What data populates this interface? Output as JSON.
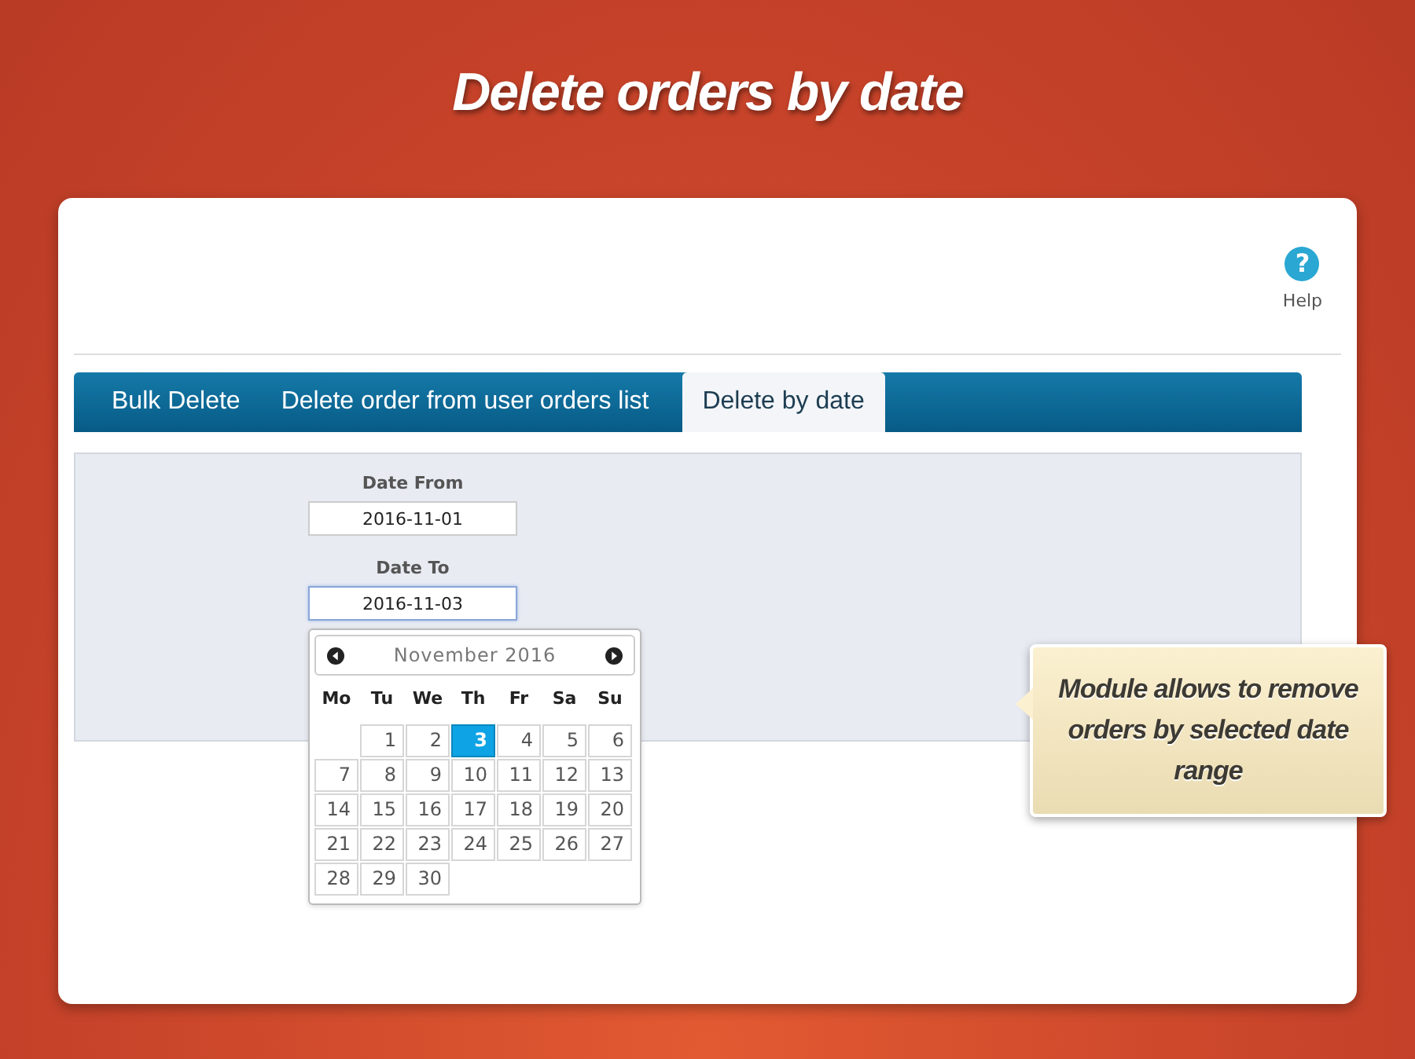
{
  "headline": "Delete orders by date",
  "help": {
    "icon_glyph": "?",
    "label": "Help"
  },
  "tabs": [
    {
      "label": "Bulk Delete",
      "selected": false
    },
    {
      "label": "Delete order from user orders list",
      "selected": false
    },
    {
      "label": "Delete by date",
      "selected": true
    }
  ],
  "fields": [
    {
      "label": "Date From",
      "value": "2016-11-01",
      "focused": false
    },
    {
      "label": "Date To",
      "value": "2016-11-03",
      "focused": true
    }
  ],
  "calendar": {
    "month_label": "November 2016",
    "weekdays": [
      "Mo",
      "Tu",
      "We",
      "Th",
      "Fr",
      "Sa",
      "Su"
    ],
    "weeks": [
      [
        {
          "label": "1",
          "selected": false
        },
        {
          "label": "2",
          "selected": false
        },
        {
          "label": "3",
          "selected": true
        },
        {
          "label": "4",
          "selected": false
        },
        {
          "label": "5",
          "selected": false
        },
        {
          "label": "6",
          "selected": false
        }
      ],
      [
        {
          "label": "7",
          "selected": false
        },
        {
          "label": "8",
          "selected": false
        },
        {
          "label": "9",
          "selected": false
        },
        {
          "label": "10",
          "selected": false
        },
        {
          "label": "11",
          "selected": false
        },
        {
          "label": "12",
          "selected": false
        },
        {
          "label": "13",
          "selected": false
        }
      ],
      [
        {
          "label": "14",
          "selected": false
        },
        {
          "label": "15",
          "selected": false
        },
        {
          "label": "16",
          "selected": false
        },
        {
          "label": "17",
          "selected": false
        },
        {
          "label": "18",
          "selected": false
        },
        {
          "label": "19",
          "selected": false
        },
        {
          "label": "20",
          "selected": false
        }
      ],
      [
        {
          "label": "21",
          "selected": false
        },
        {
          "label": "22",
          "selected": false
        },
        {
          "label": "23",
          "selected": false
        },
        {
          "label": "24",
          "selected": false
        },
        {
          "label": "25",
          "selected": false
        },
        {
          "label": "26",
          "selected": false
        },
        {
          "label": "27",
          "selected": false
        }
      ],
      [
        {
          "label": "28",
          "selected": false
        },
        {
          "label": "29",
          "selected": false
        },
        {
          "label": "30",
          "selected": false
        }
      ]
    ]
  },
  "callout": "Module allows to remove orders by selected date range"
}
